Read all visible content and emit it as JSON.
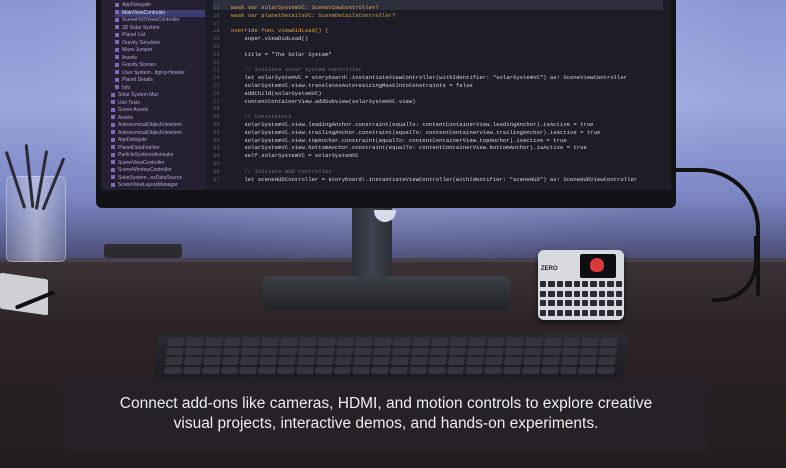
{
  "caption": {
    "line1": "Connect add-ons like cameras, HDMI, and motion controls to explore creative",
    "line2": "visual projects, interactive demos, and hands-on experiments."
  },
  "ide": {
    "sidebar": [
      "AppDelegate",
      "MainViewController",
      "SceneHUDViewController",
      "3D Solar System",
      "Planet List",
      "Gravity Simulator",
      "Maze Jumper",
      "Assets",
      "Gravity Scenes",
      "User System...ltging-Header",
      "Planet Details",
      "Info",
      "Solar System Mac",
      "Unit Tests",
      "Scene Assets",
      "Assets",
      "AstronomicalObjectViewItem",
      "AstronomicalObjectViewItem",
      "AppDelegate",
      "PlanetDataFetcher",
      "ParticleSystemsAnimator",
      "SceneViewController",
      "SceneWindowController",
      "SolarSystem...ezDataSource",
      "SceneViewLayoutManager"
    ],
    "code_lines": [
      {
        "n": "15",
        "t": "weak var solarSystemVC: SceneViewController?",
        "k": "kw"
      },
      {
        "n": "16",
        "t": "weak var planetDetailsVC: SceneDetailsController?",
        "k": "kw"
      },
      {
        "n": "17",
        "t": "",
        "k": ""
      },
      {
        "n": "18",
        "t": "override func viewDidLoad() {",
        "k": "kw"
      },
      {
        "n": "19",
        "t": "    super.viewDidLoad()",
        "k": ""
      },
      {
        "n": "20",
        "t": "",
        "k": ""
      },
      {
        "n": "21",
        "t": "    title = \"The Solar System\"",
        "k": ""
      },
      {
        "n": "22",
        "t": "",
        "k": ""
      },
      {
        "n": "23",
        "t": "    // Initiate solar system controller",
        "k": "cm"
      },
      {
        "n": "24",
        "t": "    let solarSystemVC = storyboard!.instantiateViewController(withIdentifier: \"solarSystemVC\") as! SceneViewController",
        "k": ""
      },
      {
        "n": "25",
        "t": "    solarSystemVC.view.translatesAutoresizingMaskIntoConstraints = false",
        "k": ""
      },
      {
        "n": "26",
        "t": "    addChild(solarSystemVC)",
        "k": ""
      },
      {
        "n": "27",
        "t": "    contentContainerView.addSubview(solarSystemVC.view)",
        "k": ""
      },
      {
        "n": "28",
        "t": "",
        "k": ""
      },
      {
        "n": "29",
        "t": "    // Constraints",
        "k": "cm"
      },
      {
        "n": "30",
        "t": "    solarSystemVC.view.leadingAnchor.constraint(equalTo: contentContainerView.leadingAnchor).isActive = true",
        "k": ""
      },
      {
        "n": "31",
        "t": "    solarSystemVC.view.trailingAnchor.constraint(equalTo: contentContainerView.trailingAnchor).isActive = true",
        "k": ""
      },
      {
        "n": "32",
        "t": "    solarSystemVC.view.topAnchor.constraint(equalTo: contentContainerView.topAnchor).isActive = true",
        "k": ""
      },
      {
        "n": "33",
        "t": "    solarSystemVC.view.bottomAnchor.constraint(equalTo: contentContainerView.bottomAnchor).isActive = true",
        "k": ""
      },
      {
        "n": "34",
        "t": "    self.solarSystemVC = solarSystemVC",
        "k": ""
      },
      {
        "n": "35",
        "t": "",
        "k": ""
      },
      {
        "n": "36",
        "t": "    // Initiate HUD controller",
        "k": "cm"
      },
      {
        "n": "37",
        "t": "    let sceneHUDController = storyboard!.instantiateViewController(withIdentifier: \"sceneHUD\") as! SceneHUDViewController",
        "k": ""
      }
    ]
  },
  "device": {
    "label": "ZERO"
  },
  "colors": {
    "caption_bg": "#262228",
    "sidebar_bg": "#262033",
    "keyword": "#e2a24f"
  }
}
